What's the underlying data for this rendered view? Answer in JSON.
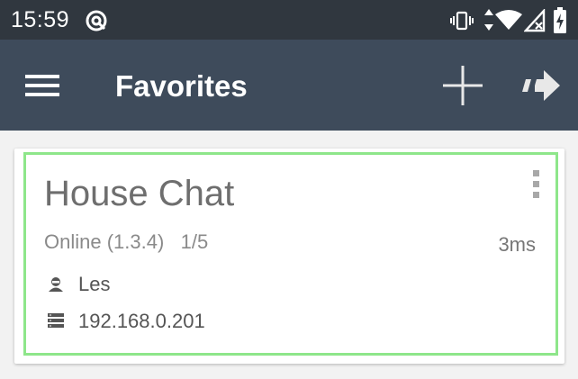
{
  "status_bar": {
    "time": "15:59",
    "icons": [
      "sync-app-icon",
      "vibrate-icon",
      "data-arrows-icon",
      "wifi-icon",
      "no-signal-icon",
      "battery-charging-icon"
    ]
  },
  "app_bar": {
    "title": "Favorites",
    "menu_icon": "hamburger-menu-icon",
    "add_icon": "plus-icon",
    "connect_icon": "arrow-right-icon"
  },
  "favorite_server": {
    "name": "House Chat",
    "status": "Online (1.3.4)   1/5",
    "ping": "3ms",
    "username": "Les",
    "address": "192.168.0.201",
    "user_icon": "user-icon",
    "address_icon": "server-icon",
    "menu_icon": "more-vert-icon"
  },
  "colors": {
    "status_bar": "#30373f",
    "app_bar": "#3e4b5b",
    "card_highlight": "#8ee68a",
    "background": "#f2f2f2"
  }
}
